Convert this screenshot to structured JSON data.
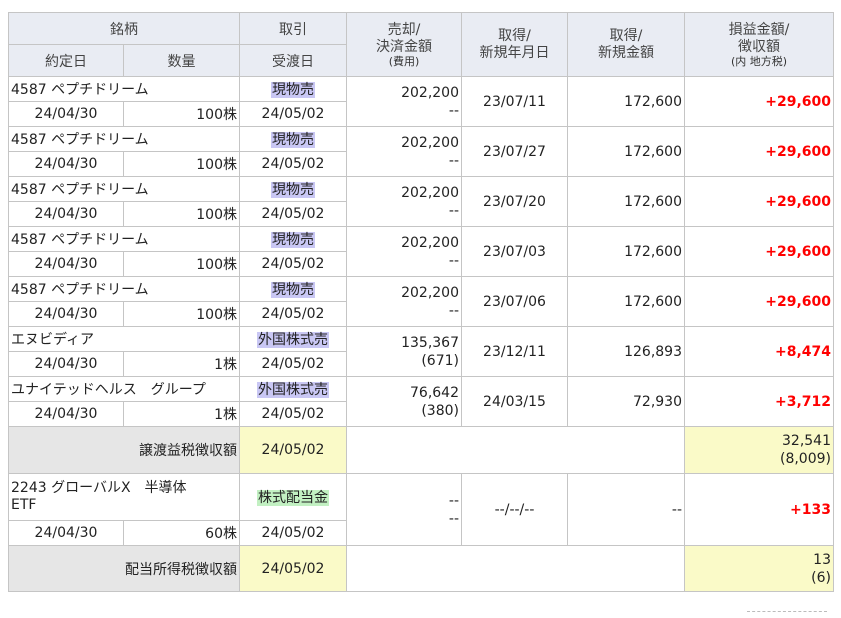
{
  "header": {
    "col1_top": "銘柄",
    "col1_bottom_a": "約定日",
    "col1_bottom_b": "数量",
    "col2_top": "取引",
    "col2_bottom": "受渡日",
    "col3_a": "売却/",
    "col3_b": "決済金額",
    "col3_sub": "(費用)",
    "col4_a": "取得/",
    "col4_b": "新規年月日",
    "col5_a": "取得/",
    "col5_b": "新規金額",
    "col6_a": "損益金額/",
    "col6_b": "徴収額",
    "col6_sub": "(内 地方税)"
  },
  "rows": [
    {
      "name": "4587 ペプチドリーム",
      "date": "24/04/30",
      "qty": "100株",
      "type": "現物売",
      "settle": "24/05/02",
      "amount": "202,200",
      "cost": "--",
      "acq_date": "23/07/11",
      "acq_amount": "172,600",
      "pl": "+29,600"
    },
    {
      "name": "4587 ペプチドリーム",
      "date": "24/04/30",
      "qty": "100株",
      "type": "現物売",
      "settle": "24/05/02",
      "amount": "202,200",
      "cost": "--",
      "acq_date": "23/07/27",
      "acq_amount": "172,600",
      "pl": "+29,600"
    },
    {
      "name": "4587 ペプチドリーム",
      "date": "24/04/30",
      "qty": "100株",
      "type": "現物売",
      "settle": "24/05/02",
      "amount": "202,200",
      "cost": "--",
      "acq_date": "23/07/20",
      "acq_amount": "172,600",
      "pl": "+29,600"
    },
    {
      "name": "4587 ペプチドリーム",
      "date": "24/04/30",
      "qty": "100株",
      "type": "現物売",
      "settle": "24/05/02",
      "amount": "202,200",
      "cost": "--",
      "acq_date": "23/07/03",
      "acq_amount": "172,600",
      "pl": "+29,600"
    },
    {
      "name": "4587 ペプチドリーム",
      "date": "24/04/30",
      "qty": "100株",
      "type": "現物売",
      "settle": "24/05/02",
      "amount": "202,200",
      "cost": "--",
      "acq_date": "23/07/06",
      "acq_amount": "172,600",
      "pl": "+29,600"
    },
    {
      "name": "エヌビディア",
      "date": "24/04/30",
      "qty": "1株",
      "type": "外国株式売",
      "settle": "24/05/02",
      "amount": "135,367",
      "cost": "(671)",
      "acq_date": "23/12/11",
      "acq_amount": "126,893",
      "pl": "+8,474"
    },
    {
      "name": "ユナイテッドヘルス　グループ",
      "date": "24/04/30",
      "qty": "1株",
      "type": "外国株式売",
      "settle": "24/05/02",
      "amount": "76,642",
      "cost": "(380)",
      "acq_date": "24/03/15",
      "acq_amount": "72,930",
      "pl": "+3,712"
    }
  ],
  "transfer_tax": {
    "label": "譲渡益税徴収額",
    "date": "24/05/02",
    "amount": "32,541",
    "local": "(8,009)"
  },
  "dividend": {
    "name_line1": "2243 グローバルX　半導体",
    "name_line2": "ETF",
    "date": "24/04/30",
    "qty": "60株",
    "type": "株式配当金",
    "settle": "24/05/02",
    "amount": "--",
    "cost": "--",
    "acq_date": "--/--/--",
    "acq_amount": "--",
    "pl": "+133"
  },
  "dividend_tax": {
    "label": "配当所得税徴収額",
    "date": "24/05/02",
    "amount": "13",
    "local": "(6)"
  },
  "colors": {
    "header_bg": "#e9ecf3",
    "badge_blue": "#c9c7f4",
    "badge_green": "#c2f0c2",
    "profit": "#ff0000",
    "tax_yellow": "#fafac8"
  }
}
